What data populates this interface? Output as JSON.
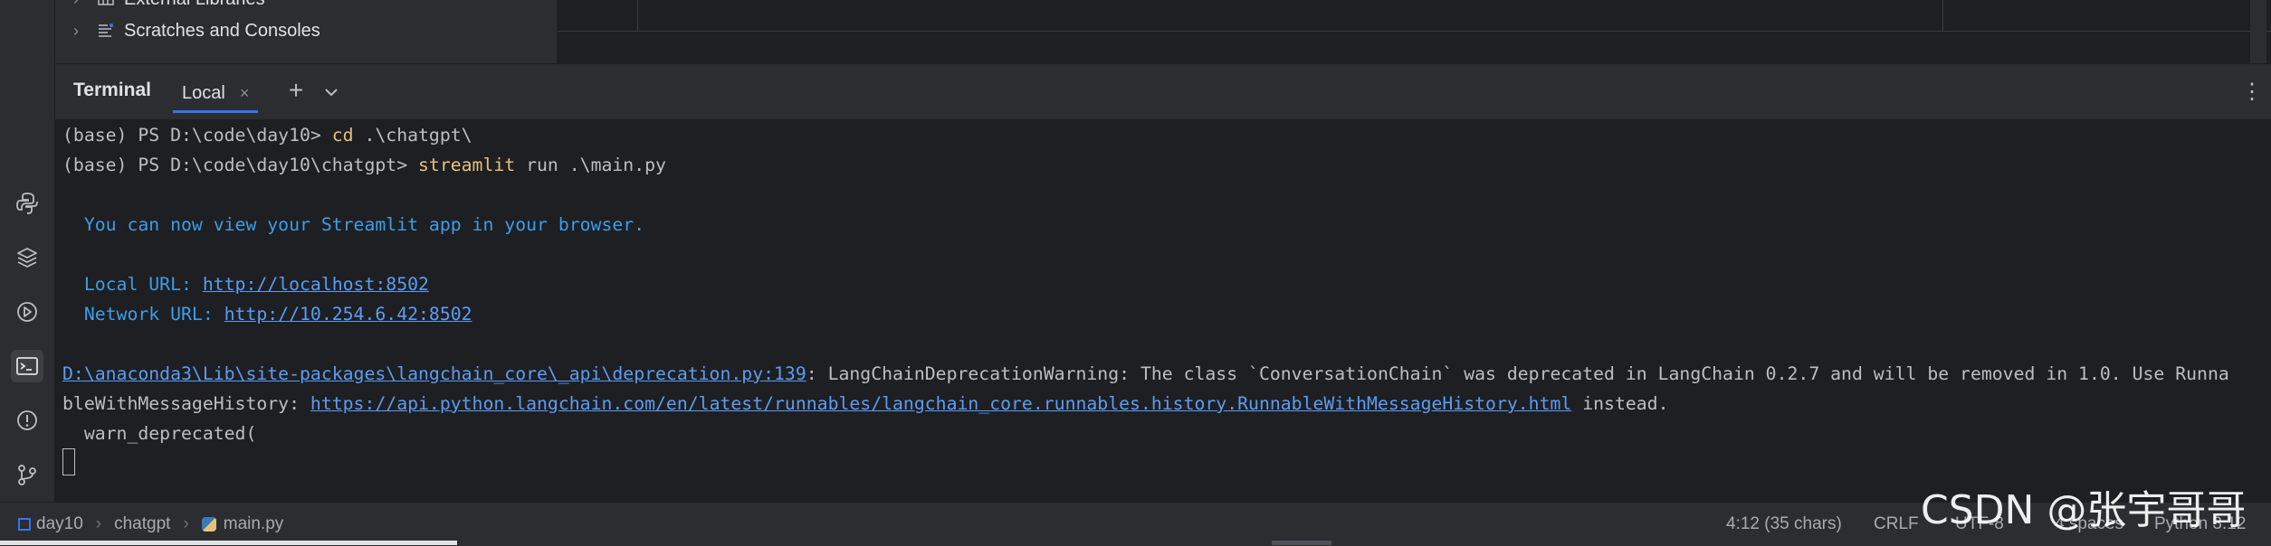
{
  "project_tree": {
    "items": [
      {
        "label": "External Libraries"
      },
      {
        "label": "Scratches and Consoles"
      }
    ]
  },
  "terminal": {
    "title": "Terminal",
    "tab_label": "Local",
    "lines": [
      {
        "prompt": "(base) PS D:\\code\\day10> ",
        "cmd": "cd",
        "rest": " .\\chatgpt\\"
      },
      {
        "prompt": "(base) PS D:\\code\\day10\\chatgpt> ",
        "cmd": "streamlit",
        "rest": " run .\\main.py"
      }
    ],
    "info_line": "  You can now view your Streamlit app in your browser.",
    "local_label": "  Local URL: ",
    "local_url": "http://localhost:8502",
    "network_label": "  Network URL: ",
    "network_url": "http://10.254.6.42:8502",
    "warn_path": "D:\\anaconda3\\Lib\\site-packages\\langchain_core\\_api\\deprecation.py:139",
    "warn_text_1": ": LangChainDeprecationWarning: The class `ConversationChain` was deprecated in LangChain 0.2.7 and will be removed in 1.0. Use Runna",
    "warn_text_2": "bleWithMessageHistory: ",
    "warn_url": "https://api.python.langchain.com/en/latest/runnables/langchain_core.runnables.history.RunnableWithMessageHistory.html",
    "warn_text_3": " instead.",
    "warn_call": "  warn_deprecated("
  },
  "statusbar": {
    "breadcrumb": [
      "day10",
      "chatgpt",
      "main.py"
    ],
    "position": "4:12 (35 chars)",
    "line_sep": "CRLF",
    "encoding": "UTF-8",
    "indent": "4 spaces",
    "interpreter": "Python 3.12"
  },
  "watermark": "CSDN @张宇哥哥",
  "colors": {
    "background": "#1e1f22",
    "panel": "#2b2d30",
    "command": "#e6c07b",
    "info": "#3d9de6",
    "link": "#5b9cf5",
    "accent": "#3574f0"
  },
  "icons": [
    "python-console-icon",
    "layers-icon",
    "services-icon",
    "terminal-icon",
    "problems-icon",
    "git-icon"
  ]
}
